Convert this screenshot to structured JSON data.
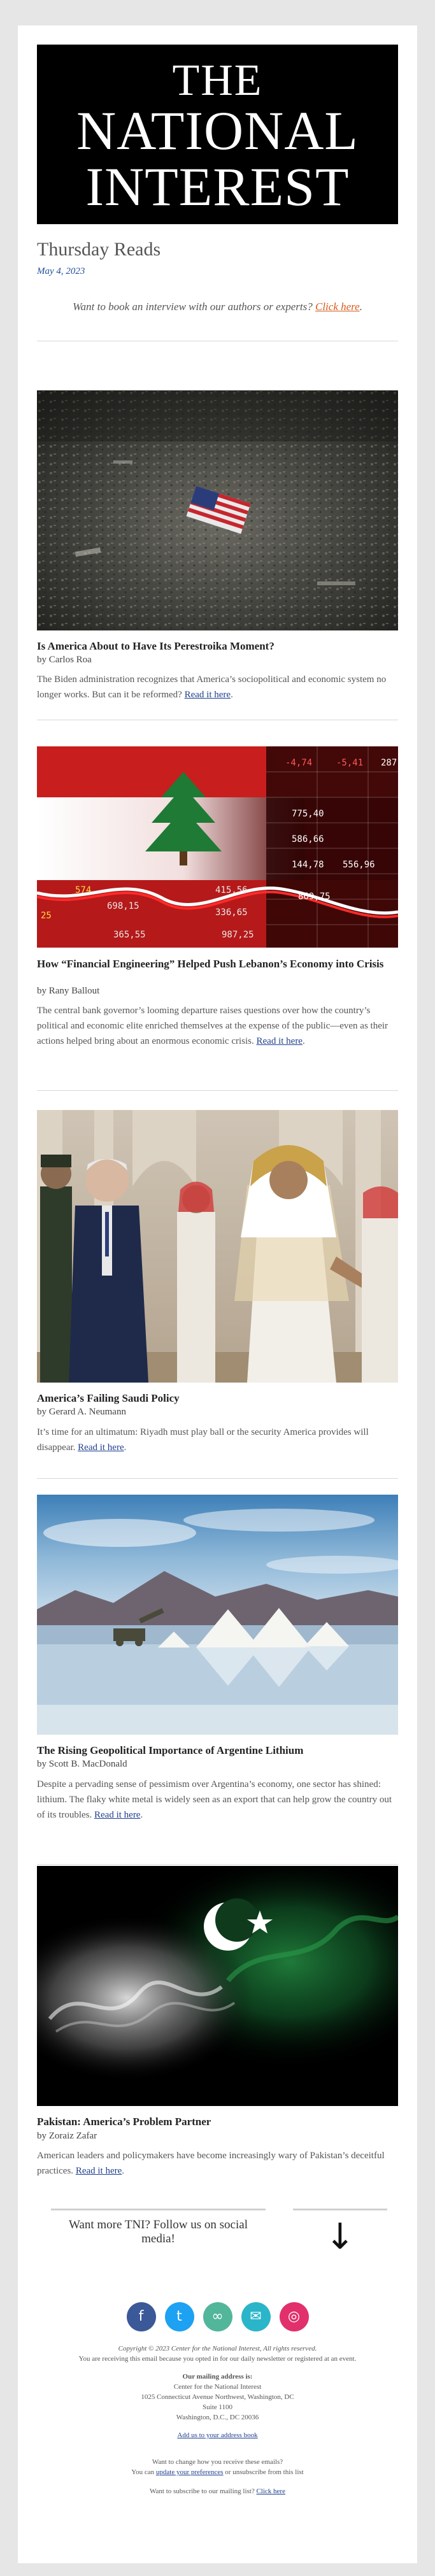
{
  "header": {
    "logo_line1": "THE",
    "logo_line2": "NATIONAL",
    "logo_line3": "INTEREST",
    "title": "Thursday Reads",
    "date": "May 4, 2023",
    "promo_text": "Want to book an interview with our authors or experts?",
    "promo_link": "Click here",
    "promo_suffix": "."
  },
  "articles": [
    {
      "title": "Is America About to Have Its Perestroika Moment?",
      "byline": "by Carlos Roa",
      "description": "The Biden administration recognizes that America’s sociopolitical and economic system no longer works. But can it be reformed?",
      "link": "Read it here"
    },
    {
      "title": "How “Financial Engineering” Helped Push Lebanon’s Economy into Crisis",
      "byline": "by Rany Ballout",
      "description": "The central bank governor’s looming departure raises questions over how the country’s political and economic elite enriched themselves at the expense of the public—even as their actions helped bring about an enormous economic crisis.",
      "link": "Read it here"
    },
    {
      "title": "America’s Failing Saudi Policy",
      "byline": "by Gerard A. Neumann",
      "description": "It’s time for an ultimatum: Riyadh must play ball or the security America provides will disappear.",
      "link": "Read it here"
    },
    {
      "title": "The Rising Geopolitical Importance of Argentine Lithium",
      "byline": "by Scott B. MacDonald",
      "description": "Despite a pervading sense of pessimism over Argentina’s economy, one sector has shined: lithium. The flaky white metal is widely seen as an export that can help grow the country out of its troubles.",
      "link": "Read it here"
    },
    {
      "title": "Pakistan: America’s Problem Partner",
      "byline": "by Zoraiz Zafar",
      "description": "American leaders and policymakers have become increasingly wary of Pakistan’s deceitful practices.",
      "link": "Read it here"
    }
  ],
  "lebanon_image_numbers": [
    "287",
    "-4,74",
    "-5,41",
    "775,40",
    "586,66",
    "144,78",
    "556,96",
    "415,56",
    "698,15",
    "336,65",
    "987,25",
    "869,75",
    "574",
    "365,55",
    "25"
  ],
  "social": {
    "prompt": "Want more TNI? Follow us on social media!",
    "arrow": "↓",
    "icons": [
      {
        "name": "facebook-icon",
        "glyph": "f",
        "color": "#3b5998"
      },
      {
        "name": "twitter-icon",
        "glyph": "t",
        "color": "#1da1f2"
      },
      {
        "name": "link-icon",
        "glyph": "∞",
        "color": "#52b69a"
      },
      {
        "name": "email-icon",
        "glyph": "✉",
        "color": "#2bb5c9"
      },
      {
        "name": "instagram-icon",
        "glyph": "◎",
        "color": "#e1306c"
      }
    ]
  },
  "footer": {
    "copyright": "Copyright © 2023 Center for the National Interest, All rights reserved.",
    "reason": "You are receiving this email because you opted in for our daily newsletter or registered at an event.",
    "address_heading": "Our mailing address is:",
    "address_line1": "Center for the National Interest",
    "address_line2": "1025 Connecticut Avenue Northwest, Washington, DC",
    "address_line3": "Suite 1100",
    "address_line4": "Washington, D.C., DC 20036",
    "address_book_link": "Add us to your address book",
    "change_prompt": "Want to change how you receive these emails?",
    "can_text": "You can",
    "preferences_link": "update your preferences",
    "or_text": "or unsubscribe from this list",
    "subscribe_prompt": "Want to subscribe to our mailing list?",
    "subscribe_link": "Click here"
  }
}
